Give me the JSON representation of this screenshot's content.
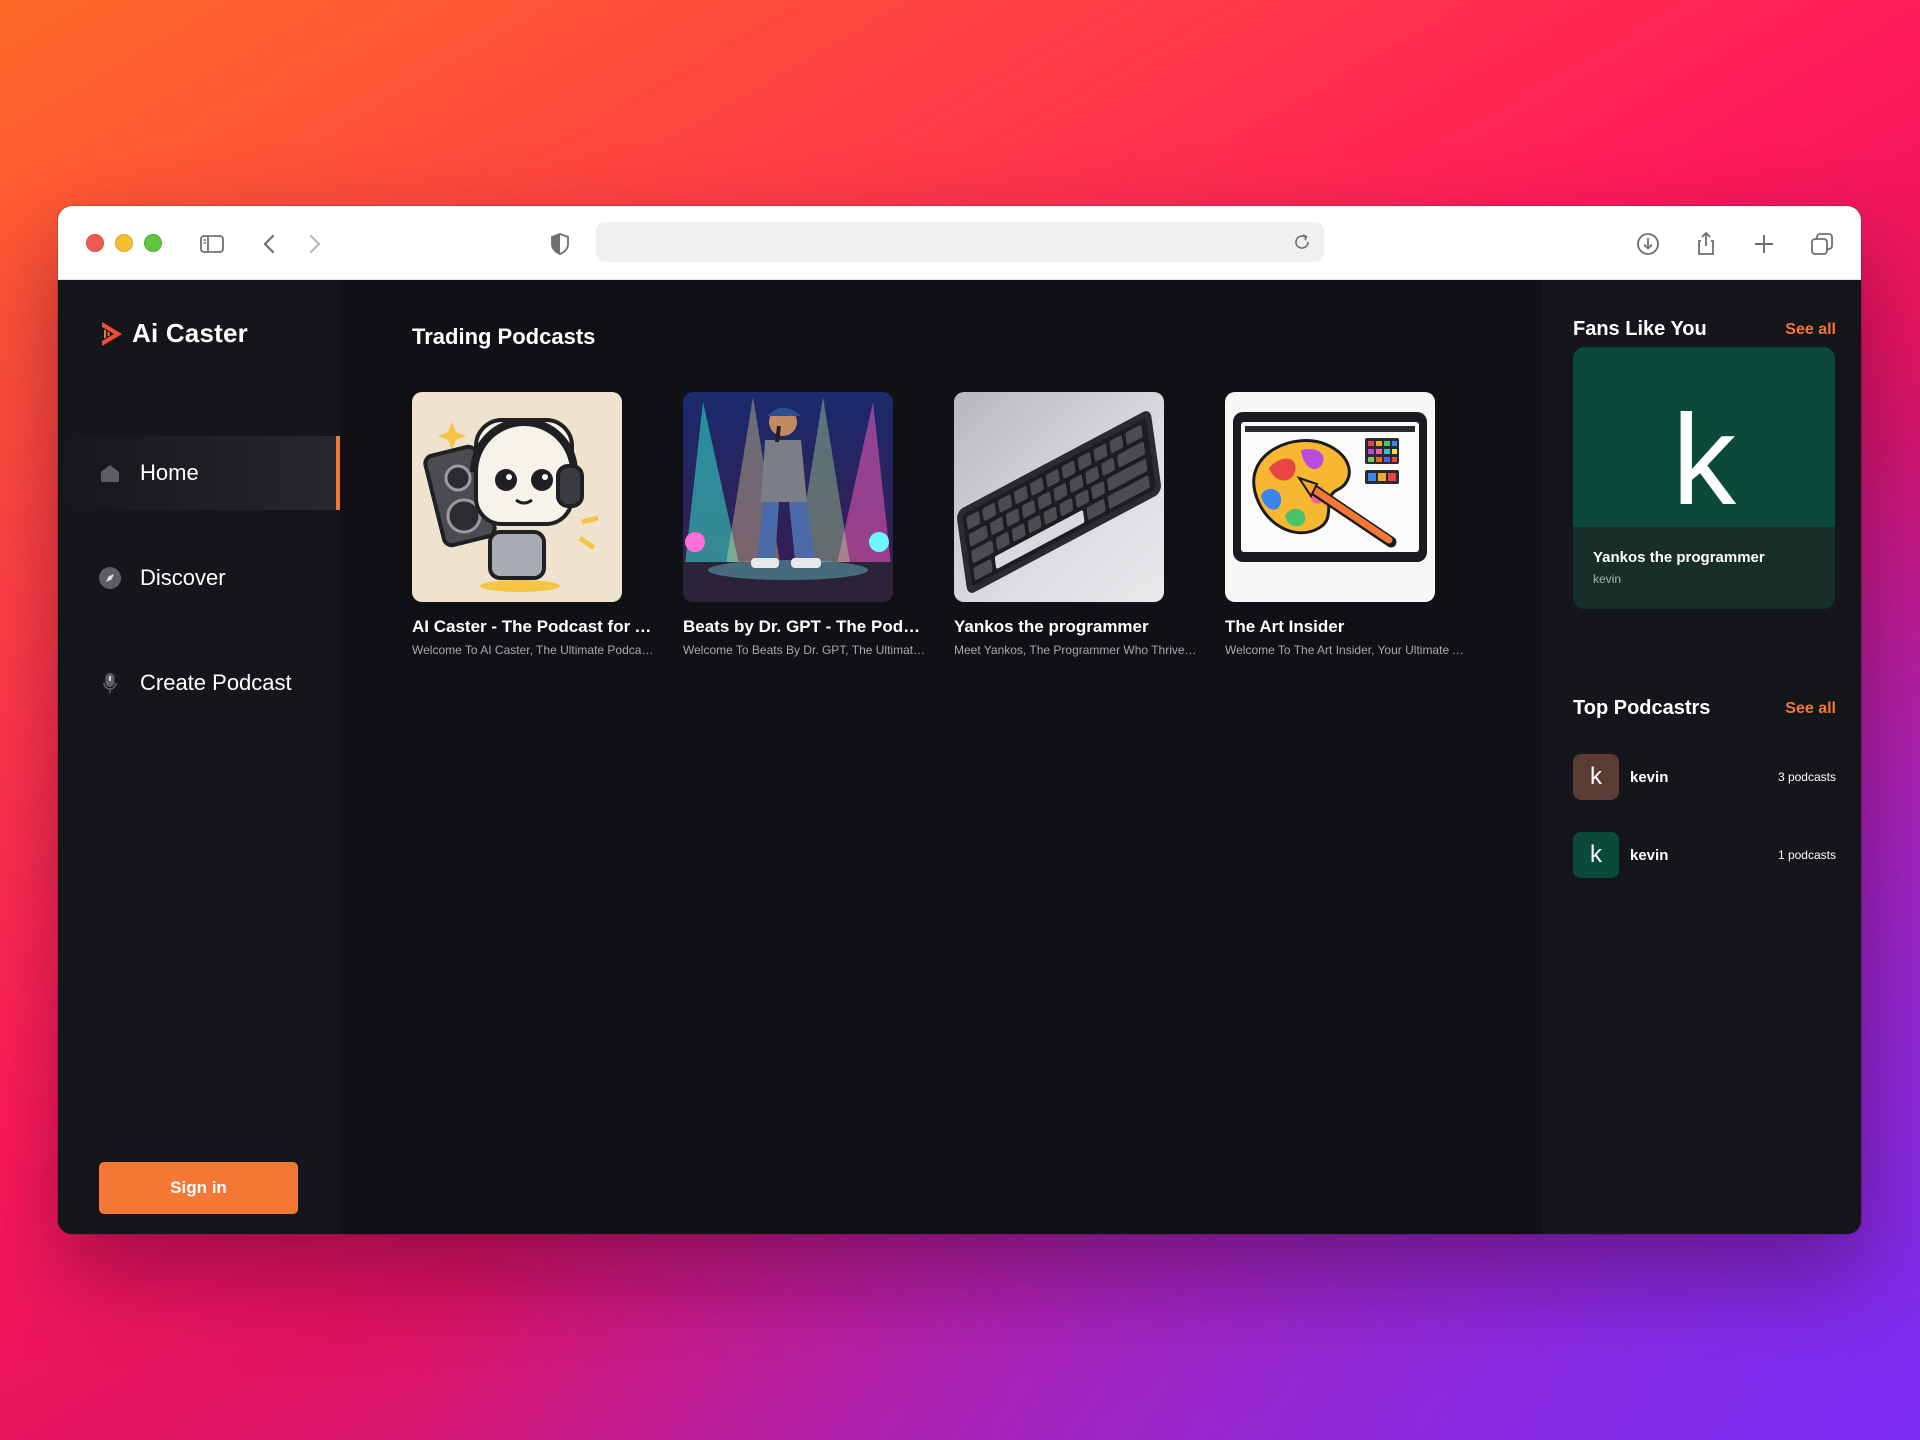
{
  "app": {
    "name": "Ai Caster",
    "accent": "#f47736"
  },
  "browser": {
    "address_value": ""
  },
  "sidebar": {
    "items": [
      {
        "label": "Home",
        "icon": "home-icon",
        "active": true
      },
      {
        "label": "Discover",
        "icon": "compass-icon",
        "active": false
      },
      {
        "label": "Create Podcast",
        "icon": "microphone-icon",
        "active": false
      }
    ],
    "signin_label": "Sign in"
  },
  "main": {
    "section_title": "Trading Podcasts",
    "podcasts": [
      {
        "title": "AI Caster - The Podcast for AI Enthusiasts",
        "description": "Welcome To AI Caster, The Ultimate Podcast for AI Enthusiasts",
        "image": "robot-with-speaker"
      },
      {
        "title": "Beats by Dr. GPT - The Podcast of AI Beats",
        "description": "Welcome To Beats By Dr. GPT, The Ultimate Podcast",
        "image": "rapper-on-stage"
      },
      {
        "title": "Yankos the programmer",
        "description": "Meet Yankos, The Programmer Who Thrives on Code",
        "image": "keyboard"
      },
      {
        "title": "The Art Insider",
        "description": "Welcome To The Art Insider, Your Ultimate Art Podcast",
        "image": "tablet-with-palette"
      }
    ]
  },
  "rightbar": {
    "fans": {
      "title": "Fans Like You",
      "see_all": "See all",
      "card": {
        "letter": "k",
        "name": "Yankos the programmer",
        "author": "kevin",
        "color": "#0b4a3b"
      }
    },
    "top": {
      "title": "Top Podcastrs",
      "see_all": "See all",
      "rows": [
        {
          "letter": "k",
          "name": "kevin",
          "count": "3 podcasts",
          "color": "#5a3c34"
        },
        {
          "letter": "k",
          "name": "kevin",
          "count": "1 podcasts",
          "color": "#0b4a3b"
        }
      ]
    }
  }
}
